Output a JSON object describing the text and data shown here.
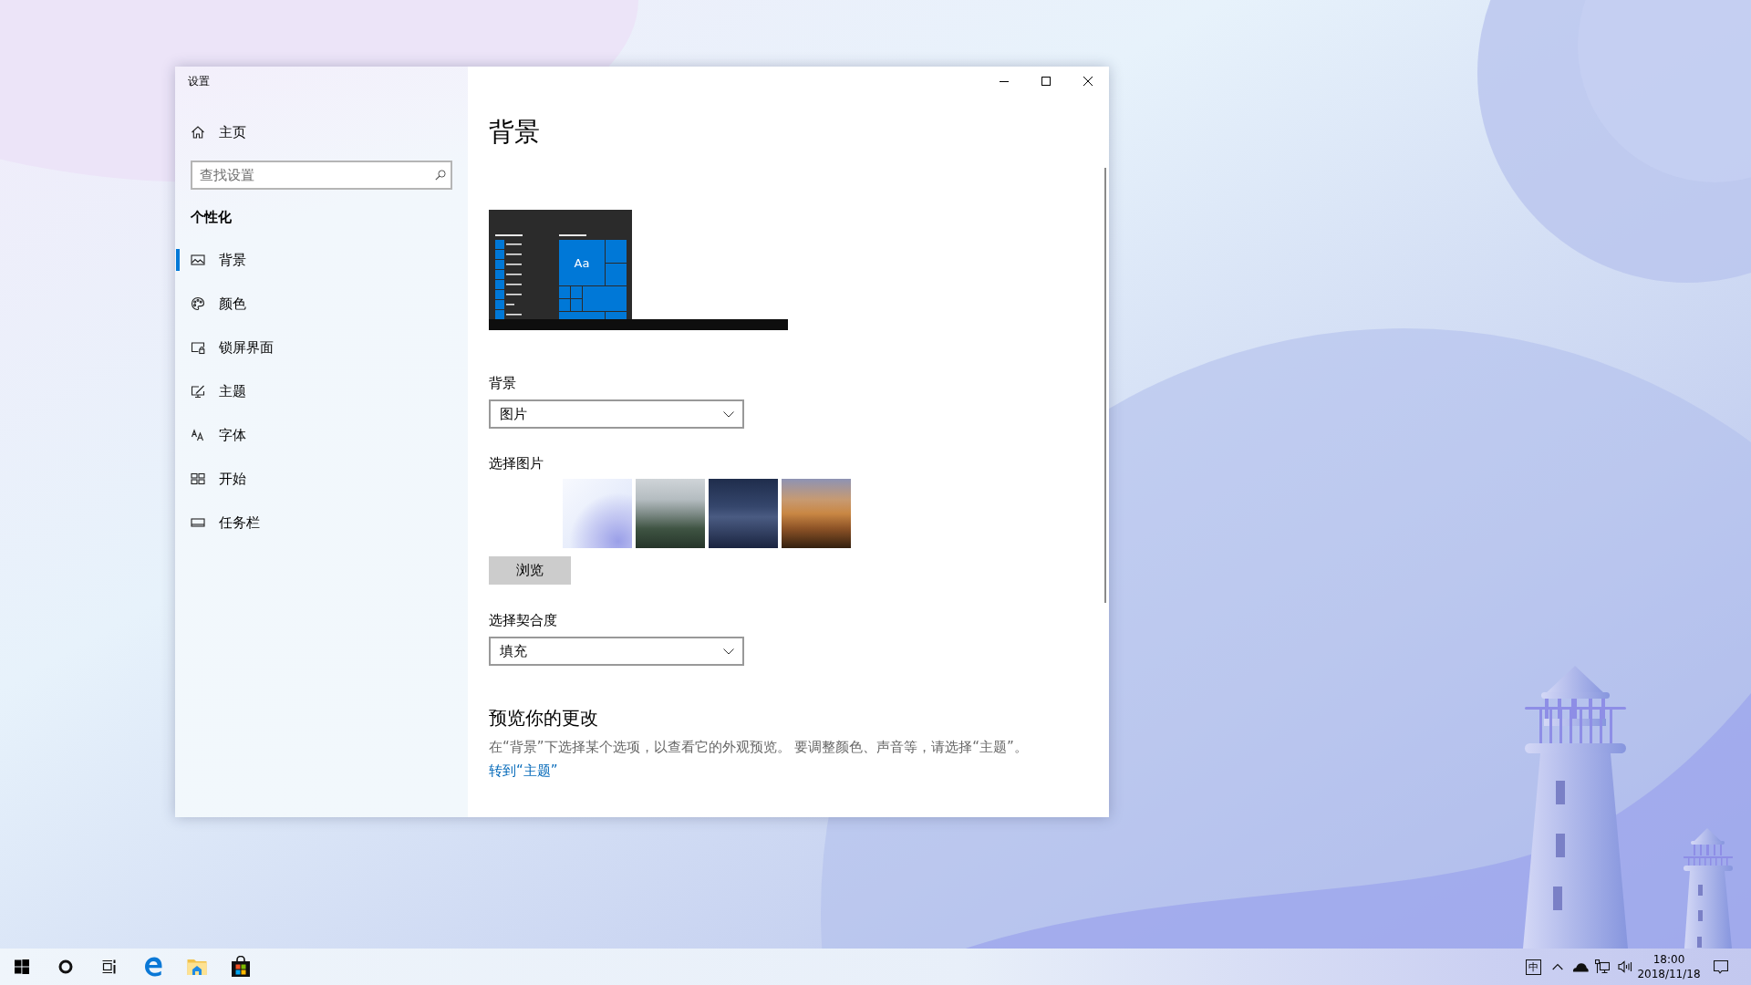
{
  "window": {
    "title": "设置"
  },
  "sidebar": {
    "home": "主页",
    "search": {
      "placeholder": "查找设置"
    },
    "section": "个性化",
    "items": [
      {
        "kind": "picture",
        "label": "背景",
        "selected": true
      },
      {
        "kind": "palette",
        "label": "颜色",
        "selected": false
      },
      {
        "kind": "lockscreen",
        "label": "锁屏界面",
        "selected": false
      },
      {
        "kind": "theme",
        "label": "主题",
        "selected": false
      },
      {
        "kind": "font",
        "label": "字体",
        "selected": false
      },
      {
        "kind": "start",
        "label": "开始",
        "selected": false
      },
      {
        "kind": "taskbar",
        "label": "任务栏",
        "selected": false
      }
    ]
  },
  "page": {
    "title": "背景",
    "preview": {
      "tile_label": "Aa"
    },
    "background": {
      "label": "背景",
      "value": "图片"
    },
    "picture": {
      "label": "选择图片",
      "thumbnails": [
        {
          "kind": "pastel"
        },
        {
          "kind": "forest"
        },
        {
          "kind": "night-dunes"
        },
        {
          "kind": "desert-dunes"
        }
      ],
      "browse_button": "浏览"
    },
    "fit": {
      "label": "选择契合度",
      "value": "填充"
    },
    "preview_changes": {
      "heading": "预览你的更改",
      "text": "在“背景”下选择某个选项，以查看它的外观预览。 要调整颜色、声音等，请选择“主题”。",
      "link": "转到“主题”"
    }
  },
  "taskbar": {
    "input_method": "中",
    "clock": {
      "time": "18:00",
      "date": "2018/11/18"
    }
  }
}
